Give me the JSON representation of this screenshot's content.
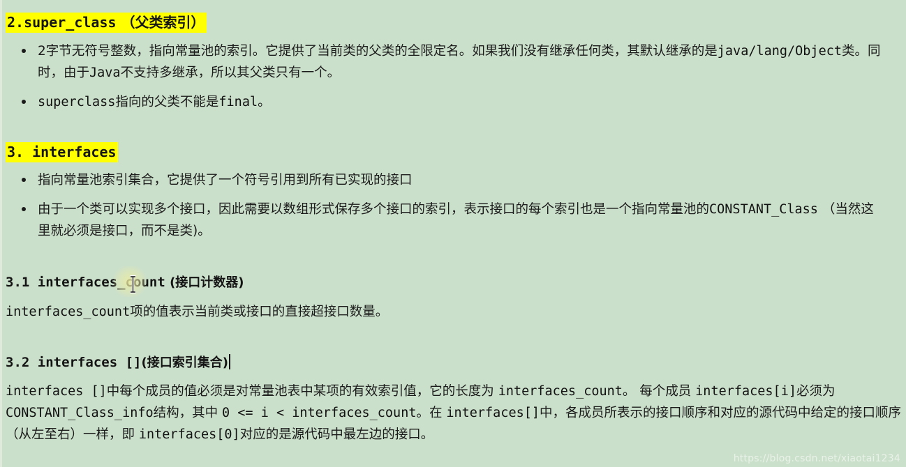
{
  "page": {
    "background_color": "#cbe0cb",
    "highlight_color": "#ffff00",
    "text_color": "#1b1b1b",
    "watermark": "https://blog.csdn.net/xiaotai1234"
  },
  "section_super_class": {
    "heading_code": "2.super_class",
    "heading_cjk": " （父类索引）",
    "bullets": [
      {
        "line1": "2字节无符号整数，指向常量池的索引。它提供了当前类的父类的全限定名。如果我们没有继承任何类，其默认继承的是",
        "line2_code": "java/lang/Object",
        "line2_rest": "类。同时，由于",
        "line2_code2": "Java",
        "line2_rest2": "不支持多继承，所以其父类只有一个。"
      },
      {
        "code": "superclass",
        "mid": "指向的父类不能是",
        "code2": "final",
        "end": "。"
      }
    ]
  },
  "section_interfaces": {
    "heading_code": "3. interfaces",
    "bullets": [
      {
        "text": "指向常量池索引集合，它提供了一个符号引用到所有已实现的接口"
      },
      {
        "line1": "由于一个类可以实现多个接口，因此需要以数组形式保存多个接口的索引，表示接口的每个索引也是一个指向常量池的",
        "line2_code": "CONSTANT_Class",
        "line2_rest": " （当然这里就必须是接口，而不是类)。"
      }
    ]
  },
  "section_interfaces_count": {
    "heading_number": "3.1 ",
    "heading_code": "interfaces_count",
    "heading_cjk": " (接口计数器)",
    "paragraph_code": "interfaces_count",
    "paragraph_rest": "项的值表示当前类或接口的直接超接口数量。"
  },
  "section_interfaces_array": {
    "heading_number": "3.2 ",
    "heading_code": "interfaces []",
    "heading_cjk": "(接口索引集合)",
    "paragraph_parts": [
      {
        "type": "mono",
        "text": "interfaces []"
      },
      {
        "type": "cjk",
        "text": "中每个成员的值必须是对常量池表中某项的有效索引值，它的长度为 "
      },
      {
        "type": "mono",
        "text": "interfaces_count"
      },
      {
        "type": "cjk",
        "text": "。 每个成员 "
      },
      {
        "type": "mono",
        "text": "interfaces[i]"
      },
      {
        "type": "cjk",
        "text": "必须为 "
      },
      {
        "type": "mono",
        "text": "CONSTANT_Class_info"
      },
      {
        "type": "cjk",
        "text": "结构，其中 "
      },
      {
        "type": "mono",
        "text": "0 <= i < interfaces_count"
      },
      {
        "type": "cjk",
        "text": "。在 "
      },
      {
        "type": "mono",
        "text": "interfaces[]"
      },
      {
        "type": "cjk",
        "text": "中，各成员所表示的接口顺序和对应的源代码中给定的接口顺序（从左至右）一样，即 "
      },
      {
        "type": "mono",
        "text": "interfaces[0]"
      },
      {
        "type": "cjk",
        "text": "对应的是源代码中最左边的接口。"
      }
    ]
  }
}
